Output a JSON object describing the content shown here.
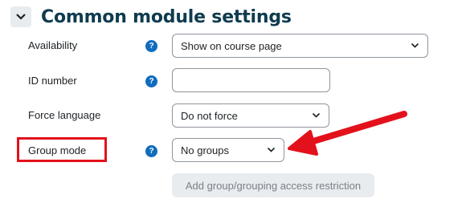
{
  "section": {
    "title": "Common module settings"
  },
  "fields": {
    "availability": {
      "label": "Availability",
      "value": "Show on course page"
    },
    "id_number": {
      "label": "ID number",
      "value": ""
    },
    "force_language": {
      "label": "Force language",
      "value": "Do not force"
    },
    "group_mode": {
      "label": "Group mode",
      "value": "No groups"
    }
  },
  "buttons": {
    "restriction": "Add group/grouping access restriction"
  },
  "icons": {
    "help": "?",
    "collapse": "chevron-down-icon"
  },
  "colors": {
    "annotation": "#e3111b",
    "title": "#0f3b4f",
    "help": "#0f6cbf"
  }
}
